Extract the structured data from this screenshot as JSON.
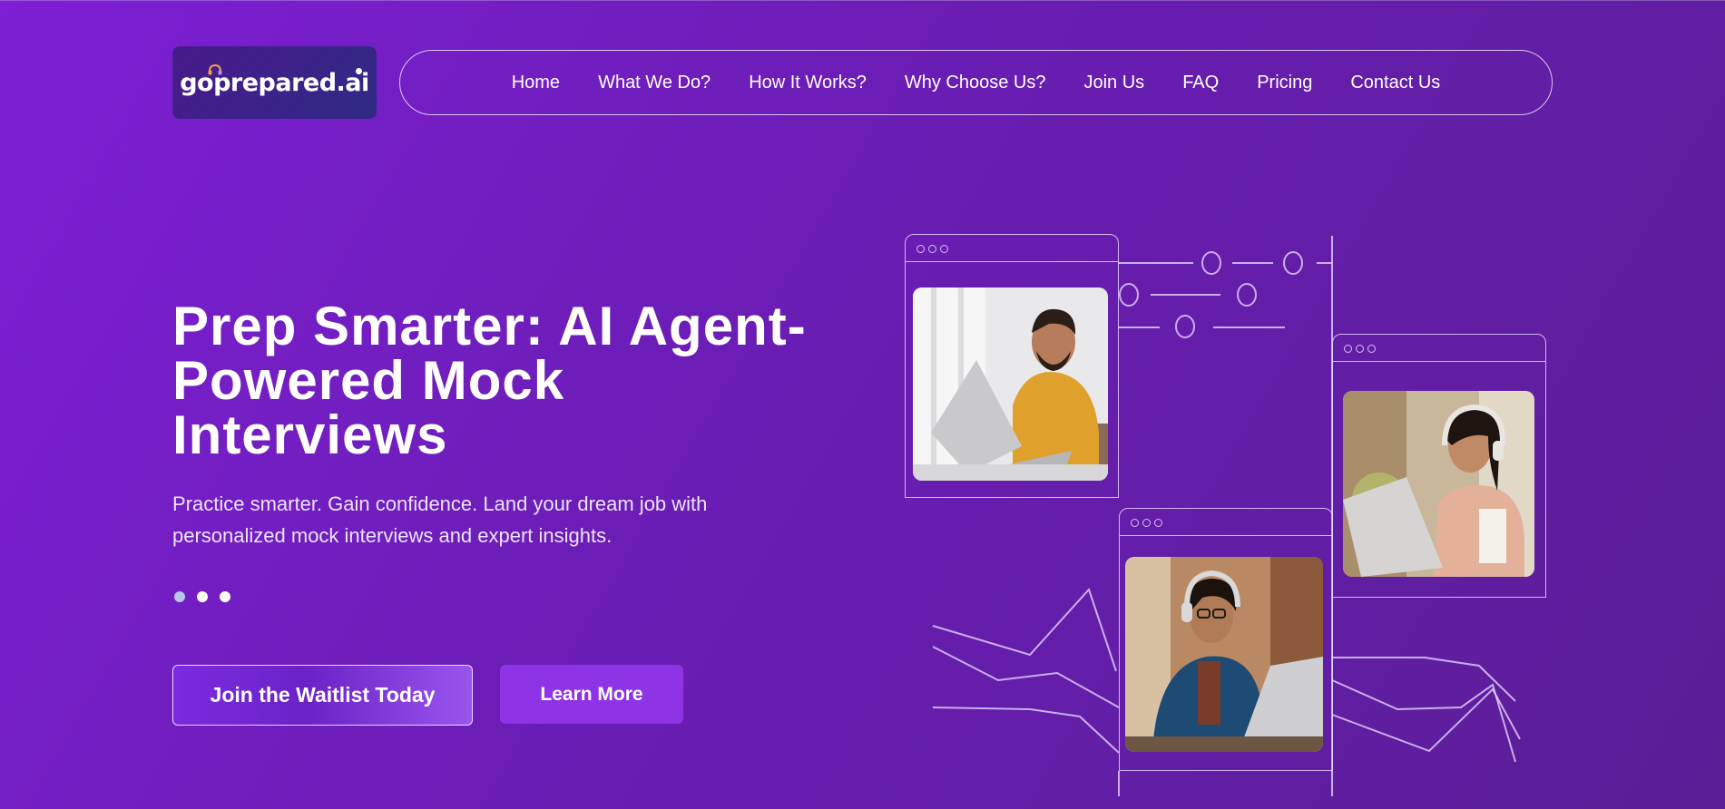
{
  "brand": {
    "name": "goprepared.ai"
  },
  "nav": {
    "items": [
      {
        "label": "Home"
      },
      {
        "label": "What We Do?"
      },
      {
        "label": "How It Works?"
      },
      {
        "label": "Why Choose Us?"
      },
      {
        "label": "Join Us"
      },
      {
        "label": "FAQ"
      },
      {
        "label": "Pricing"
      },
      {
        "label": "Contact Us"
      }
    ]
  },
  "hero": {
    "title": "Prep Smarter: AI Agent-Powered Mock Interviews",
    "subtitle": "Practice smarter. Gain confidence. Land your dream job with personalized mock interviews and expert insights.",
    "carousel_active_index": 0,
    "carousel_count": 3,
    "primary_button": "Join the Waitlist Today",
    "secondary_button": "Learn More"
  },
  "colors": {
    "background_start": "#7d1fd4",
    "background_end": "#5a1e96",
    "button_accent": "#8e34e6",
    "line_art": "#e6d2ff"
  },
  "illustration": {
    "photos": [
      "man-with-laptop-photo",
      "woman-with-headphones-laptop-photo",
      "woman-with-glasses-laptop-photo"
    ]
  }
}
